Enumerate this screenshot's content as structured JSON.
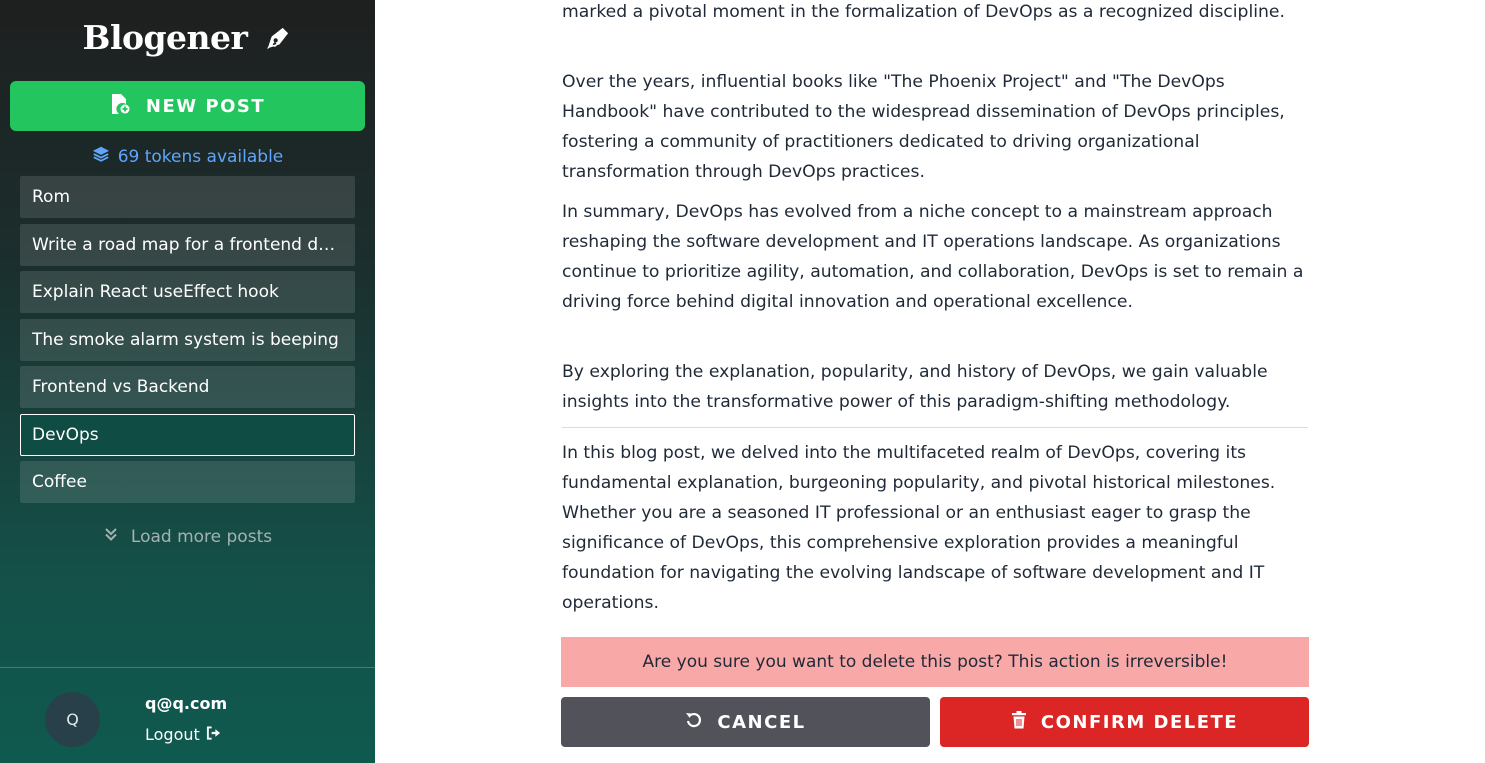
{
  "sidebar": {
    "brand": "Blogener",
    "new_post_label": "NEW POST",
    "tokens_text": "69 tokens available",
    "posts": [
      {
        "title": "Rom"
      },
      {
        "title": "Write a road map for a frontend developer"
      },
      {
        "title": "Explain React useEffect hook"
      },
      {
        "title": "The smoke alarm system is beeping"
      },
      {
        "title": "Frontend vs Backend"
      },
      {
        "title": "DevOps",
        "active": true
      },
      {
        "title": "Coffee"
      }
    ],
    "load_more_label": "Load more posts",
    "user": {
      "avatar_initial": "Q",
      "email": "q@q.com",
      "logout_label": "Logout"
    }
  },
  "article": {
    "paragraphs": [
      "marked a pivotal moment in the formalization of DevOps as a recognized discipline.",
      "Over the years, influential books like \"The Phoenix Project\" and \"The DevOps Handbook\" have contributed to the widespread dissemination of DevOps principles, fostering a community of practitioners dedicated to driving organizational transformation through DevOps practices.",
      "In summary, DevOps has evolved from a niche concept to a mainstream approach reshaping the software development and IT operations landscape. As organizations continue to prioritize agility, automation, and collaboration, DevOps is set to remain a driving force behind digital innovation and operational excellence.",
      "By exploring the explanation, popularity, and history of DevOps, we gain valuable insights into the transformative power of this paradigm-shifting methodology."
    ],
    "meta_description": "In this blog post, we delved into the multifaceted realm of DevOps, covering its fundamental explanation, burgeoning popularity, and pivotal historical milestones. Whether you are a seasoned IT professional or an enthusiast eager to grasp the significance of DevOps, this comprehensive exploration provides a meaningful foundation for navigating the evolving landscape of software development and IT operations."
  },
  "delete_confirm": {
    "message": "Are you sure you want to delete this post? This action is irreversible!",
    "cancel_label": "CANCEL",
    "confirm_label": "CONFIRM DELETE"
  },
  "colors": {
    "new_post": "#22c55e",
    "tokens": "#60a5fa",
    "alert_bg": "#f9a8a8",
    "cancel_bg": "#52525b",
    "delete_bg": "#dc2626"
  },
  "icons": {
    "brand": "pen-nib-icon",
    "new_post": "file-plus-icon",
    "tokens": "layers-icon",
    "load_more": "chevrons-down-icon",
    "logout": "sign-out-icon",
    "cancel": "undo-icon",
    "delete": "trash-icon"
  }
}
